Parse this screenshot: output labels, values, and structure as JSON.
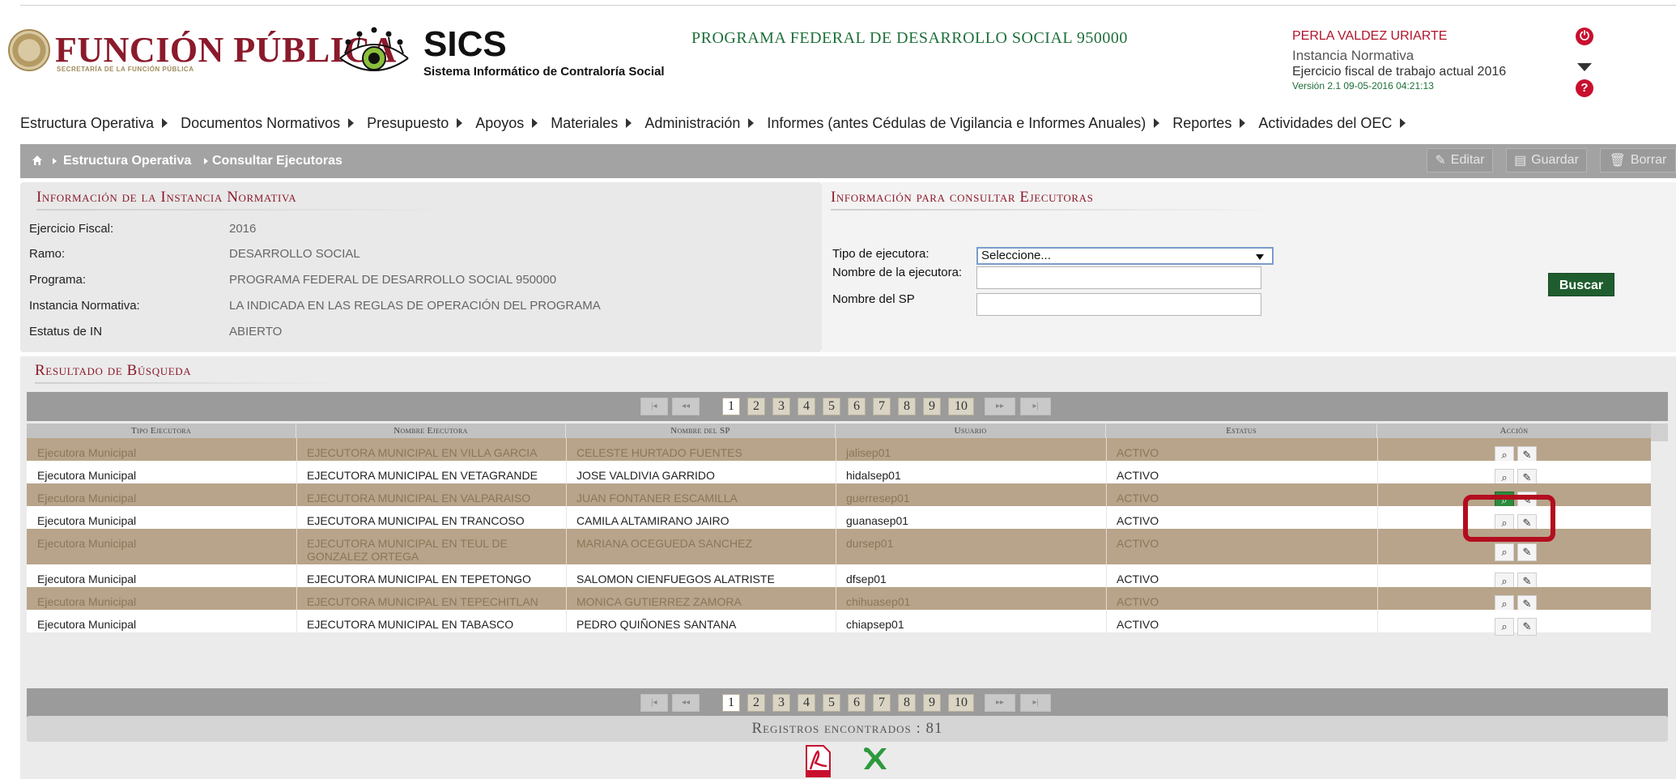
{
  "header": {
    "org_title": "FUNCIÓN PÚBLICA",
    "org_subtitle": "SECRETARÍA DE LA FUNCIÓN PÚBLICA",
    "system_title": "SICS",
    "system_subtitle": "Sistema Informático de Contraloría Social",
    "program_title": "PROGRAMA FEDERAL DE DESARROLLO SOCIAL 950000",
    "user_name": "PERLA VALDEZ URIARTE",
    "user_role": "Instancia Normativa",
    "fiscal_year": "Ejercicio fiscal de trabajo actual  2016",
    "version": "Versión 2.1   09-05-2016 04:21:13",
    "power_glyph": "⏻",
    "help_glyph": "?"
  },
  "menu": [
    {
      "label": "Estructura Operativa"
    },
    {
      "label": "Documentos Normativos"
    },
    {
      "label": "Presupuesto"
    },
    {
      "label": "Apoyos"
    },
    {
      "label": "Materiales"
    },
    {
      "label": "Administración"
    },
    {
      "label": "Informes (antes Cédulas de Vigilancia e Informes Anuales)"
    },
    {
      "label": "Reportes"
    },
    {
      "label": "Actividades del OEC"
    }
  ],
  "breadcrumb": {
    "items": [
      "Estructura Operativa",
      "Consultar Ejecutoras"
    ]
  },
  "toolbar": {
    "edit_label": "Editar",
    "save_label": "Guardar",
    "delete_label": "Borrar"
  },
  "instancia": {
    "title": "Información de la Instancia Normativa",
    "fields": [
      {
        "label": "Ejercicio Fiscal:",
        "value": "2016"
      },
      {
        "label": "Ramo:",
        "value": "DESARROLLO SOCIAL"
      },
      {
        "label": "Programa:",
        "value": "PROGRAMA FEDERAL DE DESARROLLO SOCIAL 950000"
      },
      {
        "label": "Instancia Normativa:",
        "value": "LA INDICADA EN LAS REGLAS DE OPERACIÓN DEL PROGRAMA"
      },
      {
        "label": "Estatus de IN",
        "value": "ABIERTO"
      }
    ]
  },
  "consulta": {
    "title": "Información para consultar Ejecutoras",
    "tipo_label": "Tipo de ejecutora:",
    "tipo_value": "Seleccione...",
    "nombre_label": "Nombre de la ejecutora:",
    "nombre_value": "",
    "sp_label": "Nombre del SP",
    "sp_value": "",
    "search_label": "Buscar"
  },
  "results": {
    "title": "Resultado de Búsqueda",
    "pages": [
      "1",
      "2",
      "3",
      "4",
      "5",
      "6",
      "7",
      "8",
      "9",
      "10"
    ],
    "current_page": "1",
    "nav": {
      "first": "|◂",
      "prev": "◂◂",
      "next": "▸▸",
      "last": "▸|"
    },
    "columns": [
      "Tipo Ejecutora",
      "Nombre Ejecutora",
      "Nombre del SP",
      "Usuario",
      "Estatus",
      "Acción"
    ],
    "rows": [
      {
        "tipo": "Ejecutora Municipal",
        "nombre": "EJECUTORA MUNICIPAL EN VILLA GARCIA",
        "sp": "CELESTE HURTADO FUENTES",
        "usuario": "jalisep01",
        "estatus": "ACTIVO"
      },
      {
        "tipo": "Ejecutora Municipal",
        "nombre": "EJECUTORA MUNICIPAL EN VETAGRANDE",
        "sp": "JOSE VALDIVIA GARRIDO",
        "usuario": "hidalsep01",
        "estatus": "ACTIVO"
      },
      {
        "tipo": "Ejecutora Municipal",
        "nombre": "EJECUTORA MUNICIPAL EN VALPARAISO",
        "sp": "JUAN FONTANER ESCAMILLA",
        "usuario": "guerresep01",
        "estatus": "ACTIVO"
      },
      {
        "tipo": "Ejecutora Municipal",
        "nombre": "EJECUTORA MUNICIPAL EN TRANCOSO",
        "sp": "CAMILA ALTAMIRANO JAIRO",
        "usuario": "guanasep01",
        "estatus": "ACTIVO"
      },
      {
        "tipo": "Ejecutora Municipal",
        "nombre": "EJECUTORA MUNICIPAL EN TEUL DE GONZALEZ ORTEGA",
        "sp": "MARIANA OCEGUEDA SANCHEZ",
        "usuario": "dursep01",
        "estatus": "ACTIVO"
      },
      {
        "tipo": "Ejecutora Municipal",
        "nombre": "EJECUTORA MUNICIPAL EN TEPETONGO",
        "sp": "SALOMON CIENFUEGOS ALATRISTE",
        "usuario": "dfsep01",
        "estatus": "ACTIVO"
      },
      {
        "tipo": "Ejecutora Municipal",
        "nombre": "EJECUTORA MUNICIPAL EN TEPECHITLAN",
        "sp": "MONICA GUTIERREZ ZAMORA",
        "usuario": "chihuasep01",
        "estatus": "ACTIVO"
      },
      {
        "tipo": "Ejecutora Municipal",
        "nombre": "EJECUTORA MUNICIPAL EN TABASCO",
        "sp": "PEDRO QUIÑONES SANTANA",
        "usuario": "chiapsep01",
        "estatus": "ACTIVO"
      }
    ],
    "records_label": "Registros encontrados : 81",
    "icons": {
      "view": "search-icon",
      "edit": "pencil-icon"
    }
  },
  "colors": {
    "brand": "#8b1a2b",
    "accent_green": "#1f5d2f",
    "row_dark": "#b8a48a",
    "highlight": "#b30d1f"
  }
}
